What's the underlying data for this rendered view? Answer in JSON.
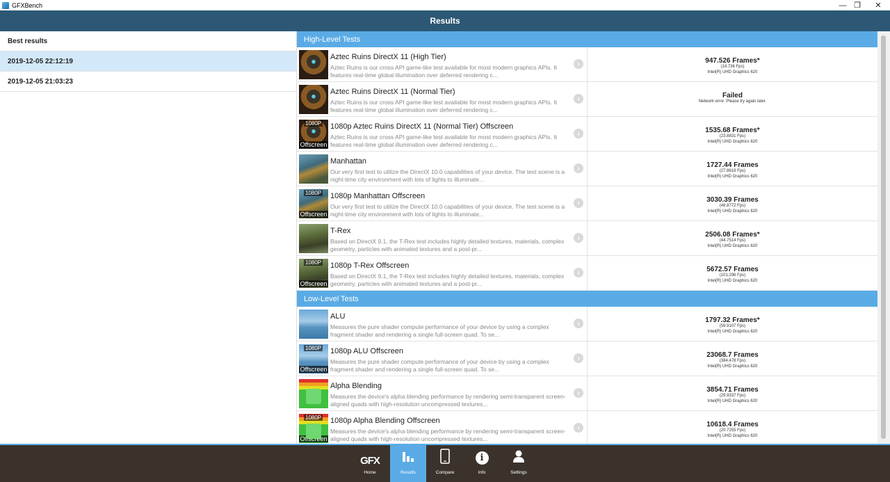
{
  "window": {
    "title": "GFXBench",
    "minimize": "—",
    "restore": "❐",
    "close": "✕"
  },
  "header": {
    "title": "Results"
  },
  "sidebar": {
    "heading": "Best results",
    "items": [
      {
        "label": "2019-12-05 22:12:19",
        "selected": true
      },
      {
        "label": "2019-12-05 21:03:23",
        "selected": false
      }
    ]
  },
  "sections": {
    "high": "High-Level Tests",
    "low": "Low-Level Tests"
  },
  "tests": [
    {
      "name": "Aztec Ruins DirectX 11 (High Tier)",
      "desc": "Aztec Ruins is our cross API game-like test available for most modern graphics APIs. It features real-time global illumination over deferred rendering c...",
      "score": "947.526 Frames*",
      "fps": "(14.736 Fps)",
      "device": "Intel(R) UHD Graphics 620",
      "thumb": "aztec",
      "offscreen": false
    },
    {
      "name": "Aztec Ruins DirectX 11 (Normal Tier)",
      "desc": "Aztec Ruins is our cross API game-like test available for most modern graphics APIs. It features real-time global illumination over deferred rendering c...",
      "score": "Failed",
      "fps": "Network error. Please try again later.",
      "device": "",
      "thumb": "aztec",
      "offscreen": false
    },
    {
      "name": "1080p Aztec Ruins DirectX 11 (Normal Tier) Offscreen",
      "desc": "Aztec Ruins is our cross API game-like test available for most modern graphics APIs. It features real-time global illumination over deferred rendering c...",
      "score": "1535.68 Frames*",
      "fps": "(23.8831 Fps)",
      "device": "Intel(R) UHD Graphics 620",
      "thumb": "aztec",
      "offscreen": true
    },
    {
      "name": "Manhattan",
      "desc": "Our very first test to utilize the DirectX 10.0 capabilities of your device. The test scene is a night-time city environment with lots of lights to illuminate...",
      "score": "1727.44 Frames",
      "fps": "(27.8619 Fps)",
      "device": "Intel(R) UHD Graphics 620",
      "thumb": "man",
      "offscreen": false
    },
    {
      "name": "1080p Manhattan Offscreen",
      "desc": "Our very first test to utilize the DirectX 10.0 capabilities of your device. The test scene is a night-time city environment with lots of lights to illuminate...",
      "score": "3030.39 Frames",
      "fps": "(48.8772 Fps)",
      "device": "Intel(R) UHD Graphics 620",
      "thumb": "man",
      "offscreen": true
    },
    {
      "name": "T-Rex",
      "desc": "Based on DirectX 9.1, the T-Rex test includes highly detailed textures, materials, complex geometry, particles with animated textures and a post-pr...",
      "score": "2506.08 Frames*",
      "fps": "(44.7514 Fps)",
      "device": "Intel(R) UHD Graphics 620",
      "thumb": "trex",
      "offscreen": false
    },
    {
      "name": "1080p T-Rex Offscreen",
      "desc": "Based on DirectX 9.1, the T-Rex test includes highly detailed textures, materials, complex geometry, particles with animated textures and a post-pr...",
      "score": "5672.57 Frames",
      "fps": "(101.296 Fps)",
      "device": "Intel(R) UHD Graphics 620",
      "thumb": "trex",
      "offscreen": true
    }
  ],
  "low_tests": [
    {
      "name": "ALU",
      "desc": "Measures the pure shader compute performance of your device by using a complex fragment shader and rendering a single full-screen quad. To se...",
      "score": "1797.32 Frames*",
      "fps": "(59.9107 Fps)",
      "device": "Intel(R) UHD Graphics 620",
      "thumb": "alu",
      "offscreen": false
    },
    {
      "name": "1080p ALU Offscreen",
      "desc": "Measures the pure shader compute performance of your device by using a complex fragment shader and rendering a single full-screen quad. To se...",
      "score": "23068.7 Frames",
      "fps": "(384.478 Fps)",
      "device": "Intel(R) UHD Graphics 620",
      "thumb": "alu",
      "offscreen": true
    },
    {
      "name": "Alpha Blending",
      "desc": "Measures the device's alpha blending performance by rendering semi-transparent screen-aligned quads with high-resolution uncompressed textures...",
      "score": "3854.71 Frames",
      "fps": "(29.9337 Fps)",
      "device": "Intel(R) UHD Graphics 620",
      "thumb": "alpha",
      "offscreen": false
    },
    {
      "name": "1080p Alpha Blending Offscreen",
      "desc": "Measures the device's alpha blending performance by rendering semi-transparent screen-aligned quads with high-resolution uncompressed textures...",
      "score": "10618.4 Frames",
      "fps": "(20.7255 Fps)",
      "device": "Intel(R) UHD Graphics 620",
      "thumb": "alpha",
      "offscreen": true
    }
  ],
  "badges": {
    "top": "1080P",
    "bottom": "Offscreen"
  },
  "bottom_nav": [
    {
      "label": "Home",
      "icon": "gfx-logo-icon",
      "glyph": "GFX",
      "active": false
    },
    {
      "label": "Results",
      "icon": "bar-chart-icon",
      "glyph": "",
      "active": true
    },
    {
      "label": "Compare",
      "icon": "phone-icon",
      "glyph": "",
      "active": false
    },
    {
      "label": "Info",
      "icon": "info-icon",
      "glyph": "i",
      "active": false
    },
    {
      "label": "Settings",
      "icon": "user-icon",
      "glyph": "",
      "active": false
    }
  ],
  "colors": {
    "header": "#2c5876",
    "section": "#5aabe5",
    "selected": "#d3e8f9",
    "bottombar": "#3a322b"
  }
}
